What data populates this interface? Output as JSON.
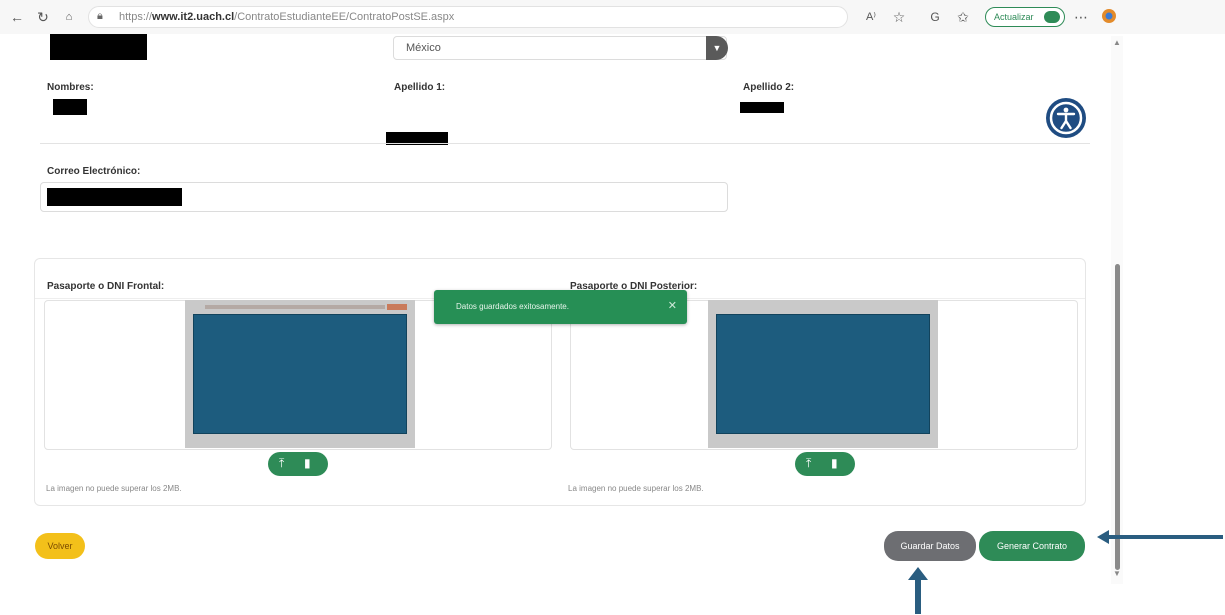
{
  "browser": {
    "url_prefix": "https://",
    "url_domain": "www.it2.uach.cl",
    "url_path": "/ContratoEstudianteEE/ContratoPostSE.aspx",
    "update_label": "Actualizar"
  },
  "form": {
    "country_value": "México",
    "nombres_label": "Nombres:",
    "apellido1_label": "Apellido 1:",
    "apellido2_label": "Apellido 2:",
    "correo_label": "Correo Electrónico:"
  },
  "documents": {
    "front_label": "Pasaporte o DNI Frontal:",
    "back_label": "Pasaporte o DNI Posterior:",
    "front_hint": "La imagen no puede superar los 2MB.",
    "back_hint": "La imagen no puede superar los 2MB."
  },
  "toast": {
    "message": "Datos guardados exitosamente."
  },
  "buttons": {
    "volver": "Volver",
    "guardar": "Guardar Datos",
    "generar": "Generar Contrato"
  },
  "colors": {
    "primary_green": "#2e8b57",
    "volver_yellow": "#f3c01a",
    "guardar_gray": "#6d6e72",
    "accessibility_blue": "#1f4c82",
    "annotation_arrow": "#2a5d80"
  }
}
